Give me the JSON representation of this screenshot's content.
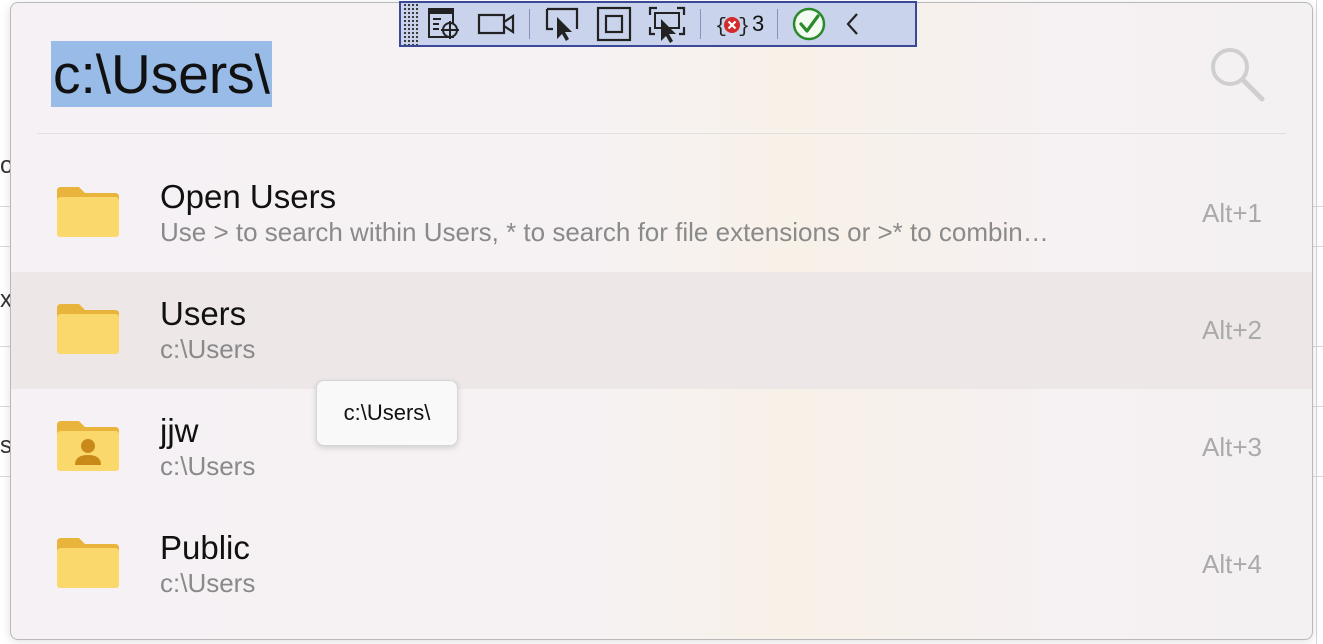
{
  "query": {
    "text": "c:\\Users\\"
  },
  "results": [
    {
      "title": "Open Users",
      "subtitle": "Use > to search within Users, * to search for file extensions or >* to combin…",
      "shortcut": "Alt+1",
      "icon": "folder-icon",
      "selected": false
    },
    {
      "title": "Users",
      "subtitle": "c:\\Users",
      "shortcut": "Alt+2",
      "icon": "folder-icon",
      "selected": true
    },
    {
      "title": "jjw",
      "subtitle": "c:\\Users",
      "shortcut": "Alt+3",
      "icon": "user-folder-icon",
      "selected": false
    },
    {
      "title": "Public",
      "subtitle": "c:\\Users",
      "shortcut": "Alt+4",
      "icon": "folder-icon",
      "selected": false
    }
  ],
  "tooltip": {
    "text": "c:\\Users\\"
  },
  "devbar": {
    "error_count": "3"
  },
  "background": {
    "edge_chars": [
      "o",
      "x",
      "s"
    ]
  },
  "colors": {
    "selection_highlight": "#99bbe8",
    "selected_row": "#ede7e8",
    "devbar_bg": "#cad3ec",
    "devbar_border": "#3b4797",
    "folder_yellow": "#f8d66a"
  }
}
